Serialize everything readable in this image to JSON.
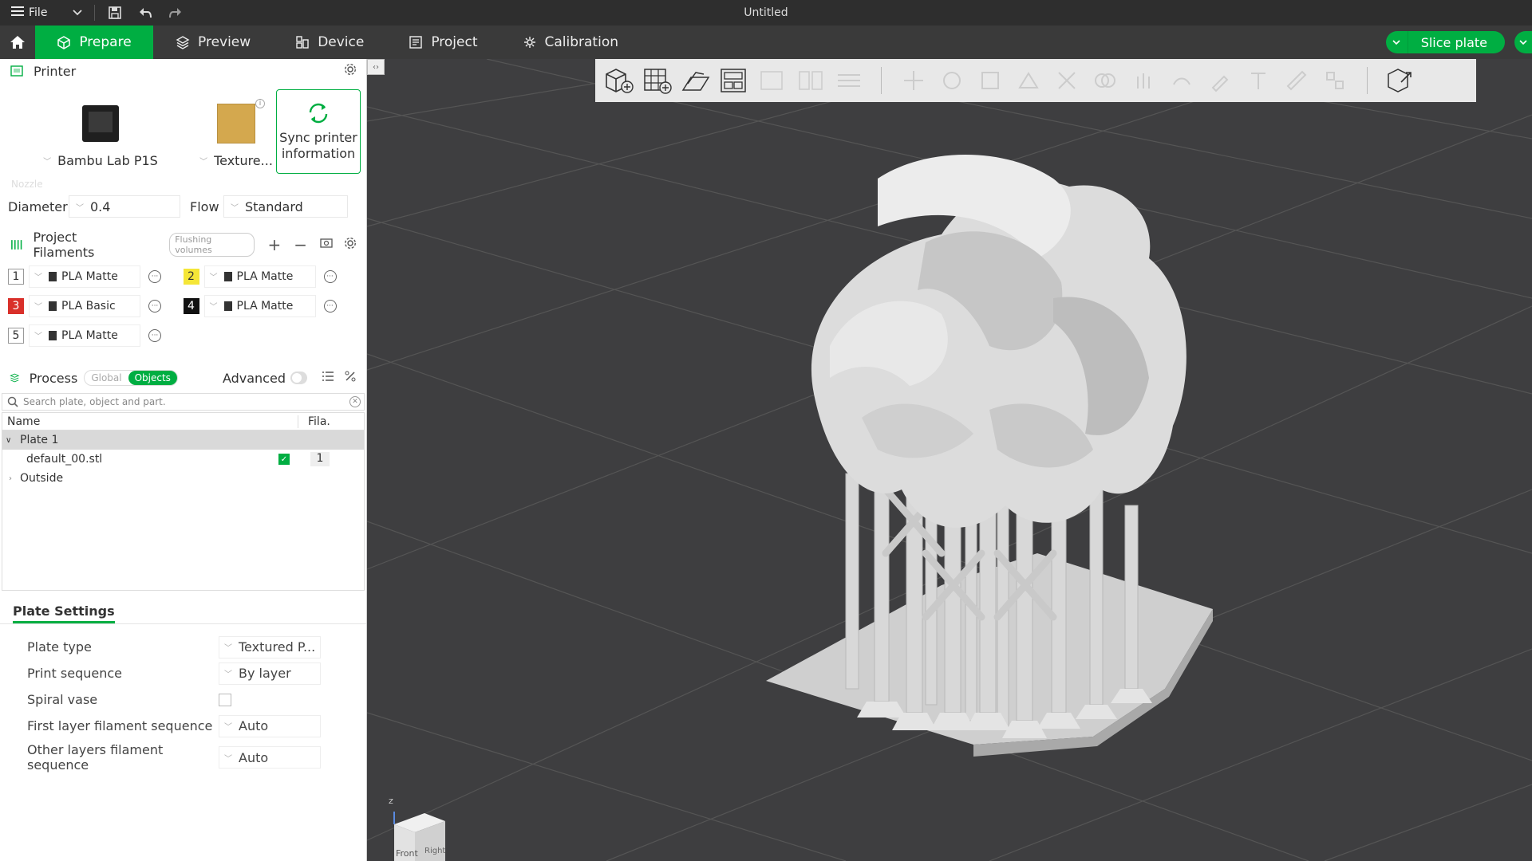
{
  "titlebar": {
    "file_label": "File",
    "window_title": "Untitled"
  },
  "tabs": [
    {
      "label": "Prepare",
      "icon": "cube-icon"
    },
    {
      "label": "Preview",
      "icon": "layers-icon"
    },
    {
      "label": "Device",
      "icon": "device-icon"
    },
    {
      "label": "Project",
      "icon": "project-icon"
    },
    {
      "label": "Calibration",
      "icon": "calibration-icon"
    }
  ],
  "slice_button": "Slice plate",
  "printer": {
    "section_title": "Printer",
    "printer_name": "Bambu Lab P1S",
    "plate_name": "Texture...",
    "sync_label_1": "Sync printer",
    "sync_label_2": "information",
    "nozzle_label": "Nozzle",
    "diameter_label": "Diameter",
    "diameter_value": "0.4",
    "flow_label": "Flow",
    "flow_value": "Standard"
  },
  "filaments": {
    "section_title": "Project Filaments",
    "flushing_label": "Flushing volumes",
    "items": [
      {
        "num": "1",
        "name": "PLA Matte",
        "color": "#ffffff",
        "text_color": "#333333"
      },
      {
        "num": "2",
        "name": "PLA Matte",
        "color": "#f5e637",
        "text_color": "#333333"
      },
      {
        "num": "3",
        "name": "PLA Basic",
        "color": "#d9302a",
        "text_color": "#ffffff"
      },
      {
        "num": "4",
        "name": "PLA Matte",
        "color": "#111111",
        "text_color": "#ffffff"
      },
      {
        "num": "5",
        "name": "PLA Matte",
        "color": "#ffffff",
        "text_color": "#333333"
      }
    ]
  },
  "process": {
    "section_title": "Process",
    "global_label": "Global",
    "objects_label": "Objects",
    "advanced_label": "Advanced",
    "search_placeholder": "Search plate, object and part.",
    "col_name": "Name",
    "col_fila": "Fila.",
    "plate_label": "Plate 1",
    "object_name": "default_00.stl",
    "object_fila": "1",
    "outside_label": "Outside"
  },
  "plate_settings": {
    "tab_label": "Plate Settings",
    "rows": [
      {
        "label": "Plate type",
        "value": "Textured P..."
      },
      {
        "label": "Print sequence",
        "value": "By layer"
      },
      {
        "label": "Spiral vase",
        "value": ""
      },
      {
        "label": "First layer filament sequence",
        "value": "Auto"
      },
      {
        "label": "Other layers filament",
        "label2": "sequence",
        "value": "Auto"
      }
    ]
  },
  "navcube": {
    "front": "Front",
    "right": "Right",
    "z": "z"
  },
  "colors": {
    "accent": "#00ae42",
    "titlebar_bg": "#2e2e2e",
    "tabbar_bg": "#3a3a3a",
    "viewport_bg": "#3e3e40"
  }
}
